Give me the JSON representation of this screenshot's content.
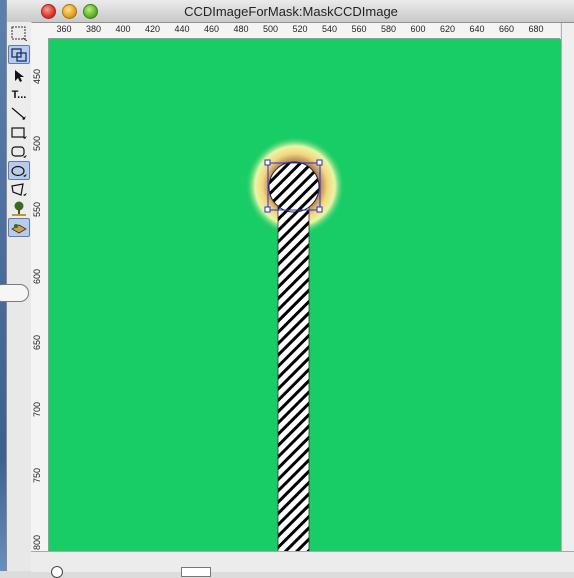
{
  "window": {
    "title": "CCDImageForMask:MaskCCDImage"
  },
  "tools": [
    {
      "icon": "marquee-icon"
    },
    {
      "icon": "pan-icon",
      "selected": true
    },
    {
      "icon": "arrow-pointer-icon"
    },
    {
      "icon": "text-tool-icon",
      "label": "T..."
    },
    {
      "icon": "line-tool-icon"
    },
    {
      "icon": "rectangle-tool-icon"
    },
    {
      "icon": "rounded-rectangle-tool-icon"
    },
    {
      "icon": "oval-tool-icon",
      "selected": true
    },
    {
      "icon": "polygon-tool-icon"
    },
    {
      "icon": "draw-env-icon"
    },
    {
      "icon": "layer-tool-icon",
      "selected": true
    }
  ],
  "ruler_x": [
    "360",
    "380",
    "400",
    "420",
    "440",
    "460",
    "480",
    "500",
    "520",
    "540",
    "560",
    "580",
    "600",
    "620",
    "640",
    "660",
    "680"
  ],
  "ruler_y": [
    "450",
    "500",
    "550",
    "600",
    "650",
    "700",
    "750",
    "800"
  ],
  "colors": {
    "image_green": "#18cc66",
    "mask_hatch": "#000000",
    "selection_handle": "#2b2bd6"
  }
}
